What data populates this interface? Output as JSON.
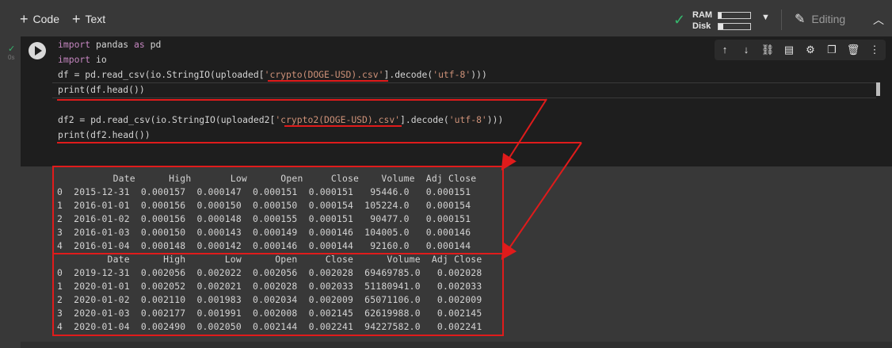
{
  "toolbar": {
    "add_code": "Code",
    "add_text": "Text",
    "ram_label": "RAM",
    "disk_label": "Disk",
    "editing_label": "Editing",
    "ram_usage_fraction": 0.1,
    "disk_usage_fraction": 0.15
  },
  "cell": {
    "status_check": "✓",
    "runtime": "0s",
    "code_lines": [
      "import pandas as pd",
      "import io",
      "df = pd.read_csv(io.StringIO(uploaded['crypto(DOGE-USD).csv'].decode('utf-8')))",
      "print(df.head())",
      "",
      "df2 = pd.read_csv(io.StringIO(uploaded2['crypto2(DOGE-USD).csv'].decode('utf-8')))",
      "print(df2.head())"
    ],
    "tools": [
      "arrow-up-icon",
      "arrow-down-icon",
      "link-icon",
      "comment-icon",
      "settings-icon",
      "mirror-icon",
      "delete-icon",
      "more-icon"
    ]
  },
  "output": {
    "table1": [
      "          Date      High       Low      Open     Close    Volume  Adj Close",
      "0  2015-12-31  0.000157  0.000147  0.000151  0.000151   95446.0   0.000151",
      "1  2016-01-01  0.000156  0.000150  0.000150  0.000154  105224.0   0.000154",
      "2  2016-01-02  0.000156  0.000148  0.000155  0.000151   90477.0   0.000151",
      "3  2016-01-03  0.000150  0.000143  0.000149  0.000146  104005.0   0.000146",
      "4  2016-01-04  0.000148  0.000142  0.000146  0.000144   92160.0   0.000144"
    ],
    "table2": [
      "         Date      High       Low      Open     Close      Volume  Adj Close",
      "0  2019-12-31  0.002056  0.002022  0.002056  0.002028  69469785.0   0.002028",
      "1  2020-01-01  0.002052  0.002021  0.002028  0.002033  51180941.0   0.002033",
      "2  2020-01-02  0.002110  0.001983  0.002034  0.002009  65071106.0   0.002009",
      "3  2020-01-03  0.002177  0.001991  0.002008  0.002145  62619988.0   0.002145",
      "4  2020-01-04  0.002490  0.002050  0.002144  0.002241  94227582.0   0.002241"
    ]
  },
  "colors": {
    "annotation": "#e01b1b",
    "keyword": "#c586c0",
    "string": "#ce9178",
    "accent_green": "#35b76d"
  }
}
